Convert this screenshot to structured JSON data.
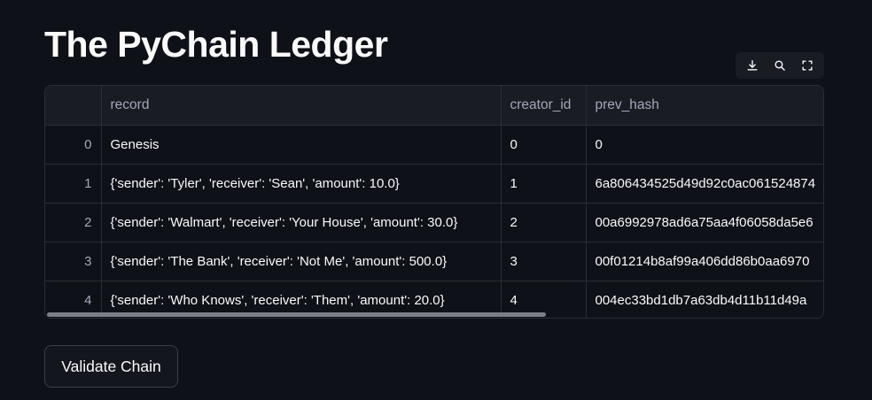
{
  "page": {
    "title": "The PyChain Ledger"
  },
  "toolbar": {
    "icons": [
      "download-icon",
      "search-icon",
      "fullscreen-icon"
    ]
  },
  "table": {
    "columns": [
      "",
      "record",
      "creator_id",
      "prev_hash"
    ],
    "rows": [
      {
        "index": "0",
        "record": "Genesis",
        "creator_id": "0",
        "prev_hash": "0"
      },
      {
        "index": "1",
        "record": "{'sender': 'Tyler', 'receiver': 'Sean', 'amount': 10.0}",
        "creator_id": "1",
        "prev_hash": "6a806434525d49d92c0ac061524874"
      },
      {
        "index": "2",
        "record": "{'sender': 'Walmart', 'receiver': 'Your House', 'amount': 30.0}",
        "creator_id": "2",
        "prev_hash": "00a6992978ad6a75aa4f06058da5e6"
      },
      {
        "index": "3",
        "record": "{'sender': 'The Bank', 'receiver': 'Not Me', 'amount': 500.0}",
        "creator_id": "3",
        "prev_hash": "00f01214b8af99a406dd86b0aa6970"
      },
      {
        "index": "4",
        "record": "{'sender': 'Who Knows', 'receiver': 'Them', 'amount': 20.0}",
        "creator_id": "4",
        "prev_hash": "004ec33bd1db7a63db4d11b11d49a"
      }
    ]
  },
  "actions": {
    "validate_label": "Validate Chain"
  },
  "colors": {
    "background": "#0e1117",
    "header_bg": "#1a1c24",
    "border": "#2a2d36",
    "text": "#fafafa",
    "muted_text": "#a3a8b8"
  }
}
